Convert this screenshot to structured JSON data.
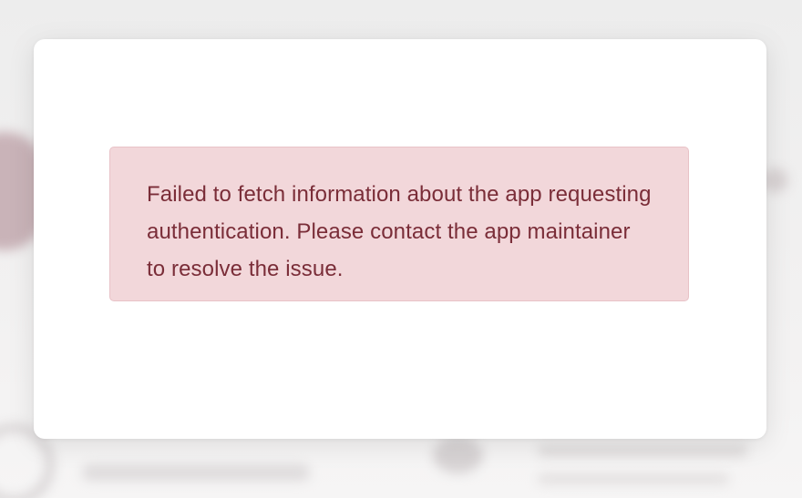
{
  "error_alert": {
    "message": "Failed to fetch information about the app requesting authentication. Please contact the app maintainer to resolve the issue."
  },
  "colors": {
    "alert_background": "#f2d7da",
    "alert_border": "#e8c2c7",
    "alert_text": "#7a2d38",
    "modal_background": "#ffffff"
  }
}
